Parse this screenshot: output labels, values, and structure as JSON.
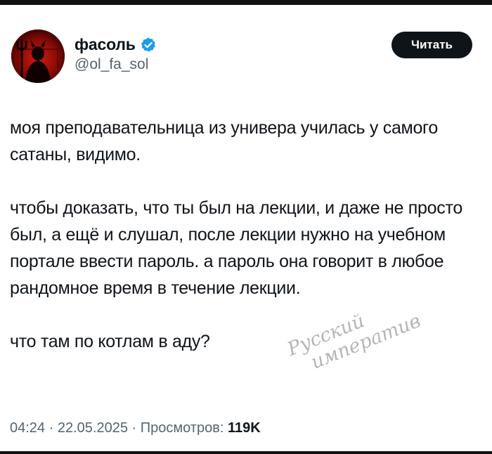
{
  "author": {
    "display_name": "фасоль",
    "handle": "@ol_fa_sol",
    "verified": true
  },
  "actions": {
    "read_label": "Читать"
  },
  "tweet": {
    "paragraphs": [
      "моя преподавательница из универа училась у самого сатаны, видимо.",
      "чтобы доказать, что ты был на лекции, и даже не просто был, а ещё и слушал, после лекции нужно на учебном портале ввести пароль. а пароль она говорит в любое рандомное время в течение лекции.",
      "что там по котлам в аду?"
    ]
  },
  "meta": {
    "time": "04:24",
    "separator": " · ",
    "date": "22.05.2025",
    "views_label": "Просмотров: ",
    "views_count": "119K"
  },
  "watermark": {
    "line1": "Русский",
    "line2": "императив"
  },
  "colors": {
    "verified": "#1d9bf0",
    "text": "#0f1419",
    "muted": "#536471",
    "button_bg": "#0f1419"
  },
  "icons": {
    "verified": "verified-badge-icon",
    "avatar": "devil-avatar"
  }
}
